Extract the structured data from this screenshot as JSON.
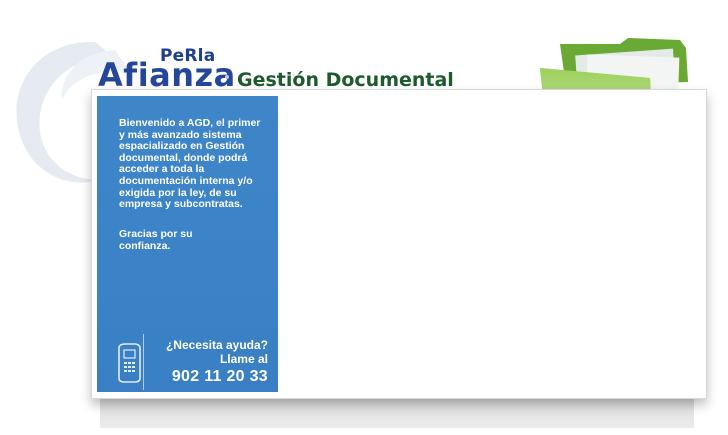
{
  "header": {
    "logo_small": "PeRla",
    "logo_main": "Afianza",
    "app_title": "Gestión Documental"
  },
  "sidebar": {
    "welcome_text": "Bienvenido a AGD, el primer y más avanzado sistema espacializado en Gestión documental, donde podrá acceder a toda la documentación interna y/o exigida por la ley, de su empresa y subcontratas.",
    "thanks_text": "Gracias por su confianza.",
    "help": {
      "question": "¿Necesita ayuda?",
      "call": "Llame al",
      "phone": "902 11 20 33"
    }
  },
  "icons": {
    "folder": "folder-icon",
    "phone": "phone-icon",
    "swoosh": "logo-swoosh-icon"
  },
  "colors": {
    "brand_blue": "#24479a",
    "title_green": "#1d5a2e",
    "sidebar_blue": "#3b82c6",
    "folder_green": "#7fbe3a"
  }
}
